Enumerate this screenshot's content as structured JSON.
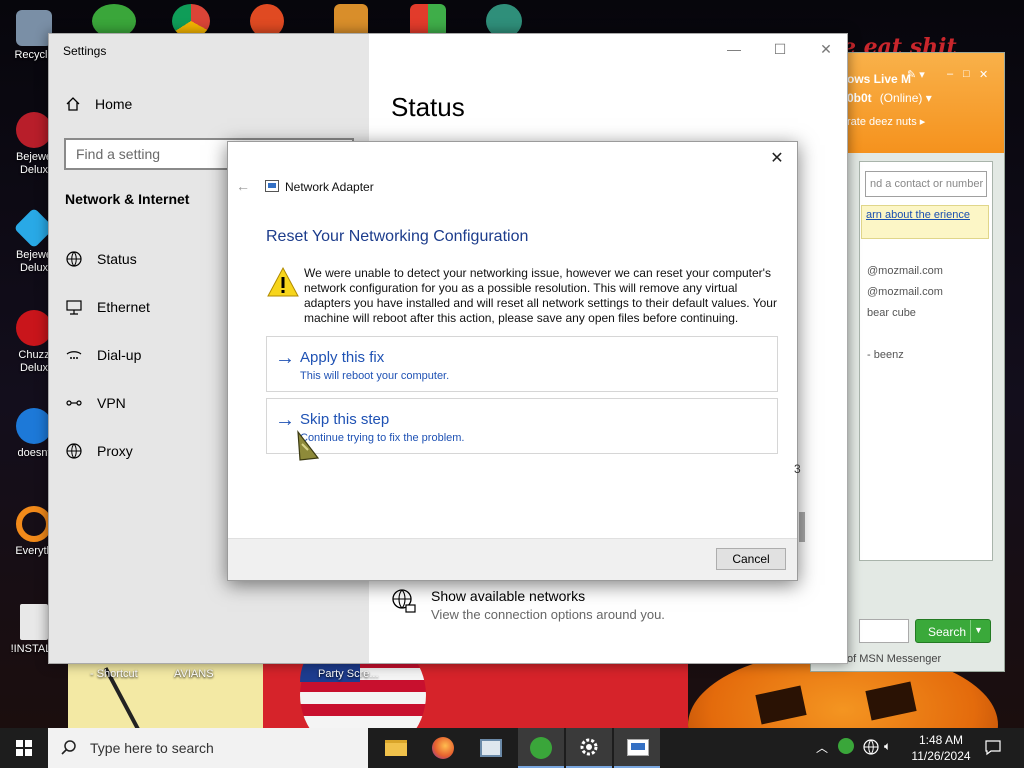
{
  "desktop": {
    "icons_left": [
      {
        "label": "Recycle",
        "color": "#7a8fa6"
      },
      {
        "label": "Bejewe Delux",
        "color": "#b81e2a"
      },
      {
        "label": "Bejewe Delux",
        "color": "#29a9e6"
      },
      {
        "label": "Chuzz Delux",
        "color": "#c9151b"
      },
      {
        "label": "doesnt",
        "color": "#1d79d8"
      },
      {
        "label": "Everyth",
        "color": "#f28a1a"
      },
      {
        "label": "!INSTALL",
        "color": "#e8e8e8"
      }
    ],
    "bottom_labels": [
      "- Shortcut",
      "AVIANS",
      "Party Scre..."
    ],
    "wall_text": "e eat shit"
  },
  "msn": {
    "title": "ows Live M",
    "nickname": "0b0t",
    "status": "(Online)",
    "personal_message": "rate deez nuts",
    "search_placeholder": "nd a contact or number",
    "banner_text": "arn about the erience",
    "contacts": [
      "@mozmail.com",
      "@mozmail.com",
      "bear cube",
      "- beenz"
    ],
    "count_text": "3",
    "search_button": "Search",
    "footer": "of MSN Messenger",
    "accent": "#f5921d"
  },
  "settings": {
    "window_title": "Settings",
    "home_label": "Home",
    "search_placeholder": "Find a setting",
    "section_title": "Network & Internet",
    "nav_items": [
      "Status",
      "Ethernet",
      "Dial-up",
      "VPN",
      "Proxy"
    ],
    "page_title": "Status",
    "available_networks_title": "Show available networks",
    "available_networks_sub": "View the connection options around you."
  },
  "dialog": {
    "app_name": "Network Adapter",
    "heading": "Reset Your Networking Configuration",
    "message": "We were unable to detect your networking issue, however we can reset your computer's network configuration for you as a possible resolution. This will remove any virtual adapters you have installed and will reset all network settings to their default values. Your machine will reboot after this action, please save any open files before continuing.",
    "options": [
      {
        "title": "Apply this fix",
        "subtitle": "This will reboot your computer."
      },
      {
        "title": "Skip this step",
        "subtitle": "Continue trying to fix the problem."
      }
    ],
    "cancel_label": "Cancel",
    "link_color": "#1f52b4"
  },
  "taskbar": {
    "search_placeholder": "Type here to search",
    "time": "1:48 AM",
    "date": "11/26/2024"
  }
}
